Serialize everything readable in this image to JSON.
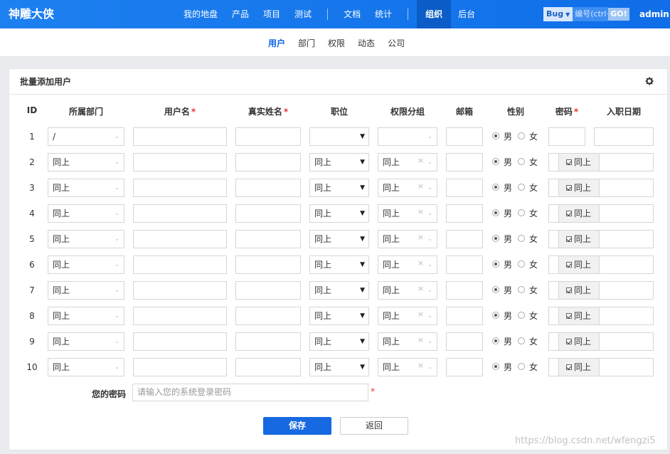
{
  "brand": "神雕大侠",
  "nav": {
    "items": [
      "我的地盘",
      "产品",
      "项目",
      "测试"
    ],
    "items2": [
      "文档",
      "统计"
    ],
    "active": "组织",
    "backend": "后台",
    "search_type": "Bug",
    "search_placeholder": "编号(ctrl+",
    "go": "GO!",
    "user": "admin"
  },
  "subnav": [
    "用户",
    "部门",
    "权限",
    "动态",
    "公司"
  ],
  "panel": {
    "title": "批量添加用户",
    "headers": {
      "id": "ID",
      "dept": "所属部门",
      "username": "用户名",
      "realname": "真实姓名",
      "position": "职位",
      "group": "权限分组",
      "email": "邮箱",
      "gender": "性别",
      "password": "密码",
      "join": "入职日期",
      "required_mark": "*"
    },
    "rows": [
      {
        "id": "1",
        "dept": "/",
        "position": "",
        "group": "",
        "same_pwd": ""
      },
      {
        "id": "2",
        "dept": "同上",
        "position": "同上",
        "group": "同上",
        "same_pwd": "同上"
      },
      {
        "id": "3",
        "dept": "同上",
        "position": "同上",
        "group": "同上",
        "same_pwd": "同上"
      },
      {
        "id": "4",
        "dept": "同上",
        "position": "同上",
        "group": "同上",
        "same_pwd": "同上"
      },
      {
        "id": "5",
        "dept": "同上",
        "position": "同上",
        "group": "同上",
        "same_pwd": "同上"
      },
      {
        "id": "6",
        "dept": "同上",
        "position": "同上",
        "group": "同上",
        "same_pwd": "同上"
      },
      {
        "id": "7",
        "dept": "同上",
        "position": "同上",
        "group": "同上",
        "same_pwd": "同上"
      },
      {
        "id": "8",
        "dept": "同上",
        "position": "同上",
        "group": "同上",
        "same_pwd": "同上"
      },
      {
        "id": "9",
        "dept": "同上",
        "position": "同上",
        "group": "同上",
        "same_pwd": "同上"
      },
      {
        "id": "10",
        "dept": "同上",
        "position": "同上",
        "group": "同上",
        "same_pwd": "同上"
      }
    ],
    "gender_male": "男",
    "gender_female": "女",
    "your_password_label": "您的密码",
    "your_password_placeholder": "请输入您的系统登录密码",
    "save": "保存",
    "back": "返回"
  },
  "watermark": "https://blog.csdn.net/wfengzi5"
}
